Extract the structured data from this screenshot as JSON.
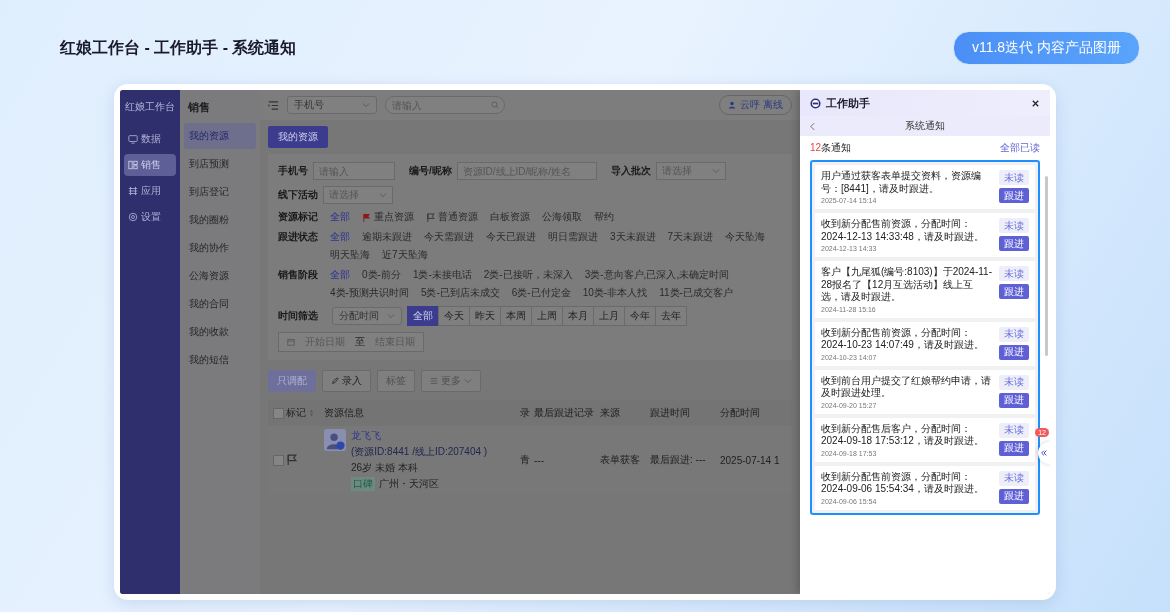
{
  "page_title": "红娘工作台 - 工作助手 - 系统通知",
  "version_badge": "v11.8迭代 内容产品图册",
  "app": {
    "brand": "红娘工作台",
    "nav": [
      {
        "label": "数据",
        "selected": false
      },
      {
        "label": "销售",
        "selected": true
      },
      {
        "label": "应用",
        "selected": false
      },
      {
        "label": "设置",
        "selected": false
      }
    ],
    "subnav": {
      "title": "销售",
      "items": [
        {
          "label": "我的资源",
          "selected": true
        },
        {
          "label": "到店预测",
          "selected": false
        },
        {
          "label": "到店登记",
          "selected": false
        },
        {
          "label": "我的圈粉",
          "selected": false
        },
        {
          "label": "我的协作",
          "selected": false
        },
        {
          "label": "公海资源",
          "selected": false
        },
        {
          "label": "我的合同",
          "selected": false
        },
        {
          "label": "我的收款",
          "selected": false
        },
        {
          "label": "我的短信",
          "selected": false
        }
      ]
    },
    "topbar": {
      "search_type": "手机号",
      "search_placeholder": "请输入",
      "call_button": "云呼 离线"
    },
    "tab": "我的资源",
    "fields": [
      {
        "label": "手机号",
        "placeholder": "请输入",
        "kind": "input"
      },
      {
        "label": "编号/昵称",
        "placeholder": "资源ID/线上ID/昵称/姓名",
        "kind": "input"
      },
      {
        "label": "导入批次",
        "placeholder": "请选择",
        "kind": "select"
      },
      {
        "label": "线下活动",
        "placeholder": "请选择",
        "kind": "select"
      }
    ],
    "filters": [
      {
        "label": "资源标记",
        "options": [
          {
            "text": "全部",
            "selected": true,
            "kind": "plain"
          },
          {
            "text": "重点资源",
            "selected": false,
            "kind": "important"
          },
          {
            "text": "普通资源",
            "selected": false,
            "kind": "normal"
          },
          {
            "text": "白板资源",
            "selected": false,
            "kind": "plain"
          },
          {
            "text": "公海领取",
            "selected": false,
            "kind": "plain"
          },
          {
            "text": "帮约",
            "selected": false,
            "kind": "plain"
          }
        ]
      },
      {
        "label": "跟进状态",
        "options": [
          {
            "text": "全部",
            "selected": true,
            "kind": "plain"
          },
          {
            "text": "逾期未跟进",
            "selected": false,
            "kind": "plain"
          },
          {
            "text": "今天需跟进",
            "selected": false,
            "kind": "plain"
          },
          {
            "text": "今天已跟进",
            "selected": false,
            "kind": "plain"
          },
          {
            "text": "明日需跟进",
            "selected": false,
            "kind": "plain"
          },
          {
            "text": "3天未跟进",
            "selected": false,
            "kind": "plain"
          },
          {
            "text": "7天未跟进",
            "selected": false,
            "kind": "plain"
          },
          {
            "text": "今天坠海",
            "selected": false,
            "kind": "plain"
          },
          {
            "text": "明天坠海",
            "selected": false,
            "kind": "plain"
          },
          {
            "text": "近7天坠海",
            "selected": false,
            "kind": "plain"
          }
        ]
      },
      {
        "label": "销售阶段",
        "options": [
          {
            "text": "全部",
            "selected": true,
            "kind": "plain"
          },
          {
            "text": "0类-前分",
            "selected": false,
            "kind": "plain"
          },
          {
            "text": "1类-未接电话",
            "selected": false,
            "kind": "plain"
          },
          {
            "text": "2类-已接听，未深入",
            "selected": false,
            "kind": "plain"
          },
          {
            "text": "3类-意向客户,已深入,未确定时间",
            "selected": false,
            "kind": "plain"
          },
          {
            "text": "4类-预测共识时间",
            "selected": false,
            "kind": "plain"
          },
          {
            "text": "5类-已到店未成交",
            "selected": false,
            "kind": "plain"
          },
          {
            "text": "6类-已付定金",
            "selected": false,
            "kind": "plain"
          },
          {
            "text": "10类-非本人找",
            "selected": false,
            "kind": "plain"
          },
          {
            "text": "11类-已成交客户",
            "selected": false,
            "kind": "plain"
          }
        ]
      }
    ],
    "time_filter": {
      "label": "时间筛选",
      "field": "分配时间",
      "ranges": [
        {
          "text": "全部",
          "selected": true
        },
        {
          "text": "今天",
          "selected": false
        },
        {
          "text": "昨天",
          "selected": false
        },
        {
          "text": "本周",
          "selected": false
        },
        {
          "text": "上周",
          "selected": false
        },
        {
          "text": "本月",
          "selected": false
        },
        {
          "text": "上月",
          "selected": false
        },
        {
          "text": "今年",
          "selected": false
        },
        {
          "text": "去年",
          "selected": false
        }
      ],
      "start_placeholder": "开始日期",
      "separator": "至",
      "end_placeholder": "结束日期"
    },
    "actions": [
      {
        "label": "只调配",
        "kind": "primary",
        "disabled": true
      },
      {
        "label": "录入",
        "kind": "edit",
        "disabled": false
      },
      {
        "label": "标签",
        "kind": "plain",
        "disabled": true
      },
      {
        "label": "更多",
        "kind": "menu",
        "disabled": true
      }
    ],
    "table": {
      "header_checked": false,
      "mark_column": "标记",
      "info_column": "资源信息",
      "columns": [
        "录",
        "最后跟进记录",
        "来源",
        "跟进时间",
        "分配时间"
      ],
      "rows": [
        {
          "checked": false,
          "name": "龙飞飞",
          "ids": "(资源ID:8441 /线上ID:207404 )",
          "details": "26岁 未婚 本科",
          "tag": "口碑",
          "location": "广州・天河区",
          "cells": [
            "青",
            "---",
            "表单获客",
            "最后跟进: ---",
            "2025-07-14 1"
          ]
        }
      ]
    }
  },
  "assistant": {
    "title": "工作助手",
    "subtitle": "系统通知",
    "count": "12",
    "count_label": "条通知",
    "mark_all": "全部已读",
    "badge": "12",
    "notices": [
      {
        "message": "用户通过获客表单提交资料，资源编号：[8441]，请及时跟进。",
        "time": "2025-07-14 15:14",
        "status": "未读",
        "action": "跟进"
      },
      {
        "message": "收到新分配售前资源，分配时间：2024-12-13 14:33:48，请及时跟进。",
        "time": "2024-12-13 14:33",
        "status": "未读",
        "action": "跟进"
      },
      {
        "message": "客户【九尾狐(编号:8103)】于2024-11-28报名了【12月互选活动】线上互选，请及时跟进。",
        "time": "2024-11-28 15:16",
        "status": "未读",
        "action": "跟进"
      },
      {
        "message": "收到新分配售前资源，分配时间：2024-10-23 14:07:49，请及时跟进。",
        "time": "2024-10-23 14:07",
        "status": "未读",
        "action": "跟进"
      },
      {
        "message": "收到前台用户提交了红娘帮约申请，请及时跟进处理。",
        "time": "2024-09-20 15:27",
        "status": "未读",
        "action": "跟进"
      },
      {
        "message": "收到新分配售后客户，分配时间：2024-09-18 17:53:12，请及时跟进。",
        "time": "2024-09-18 17:53",
        "status": "未读",
        "action": "跟进"
      },
      {
        "message": "收到新分配售前资源，分配时间：2024-09-06 15:54:34，请及时跟进。",
        "time": "2024-09-06 15:54",
        "status": "未读",
        "action": "跟进"
      }
    ]
  }
}
